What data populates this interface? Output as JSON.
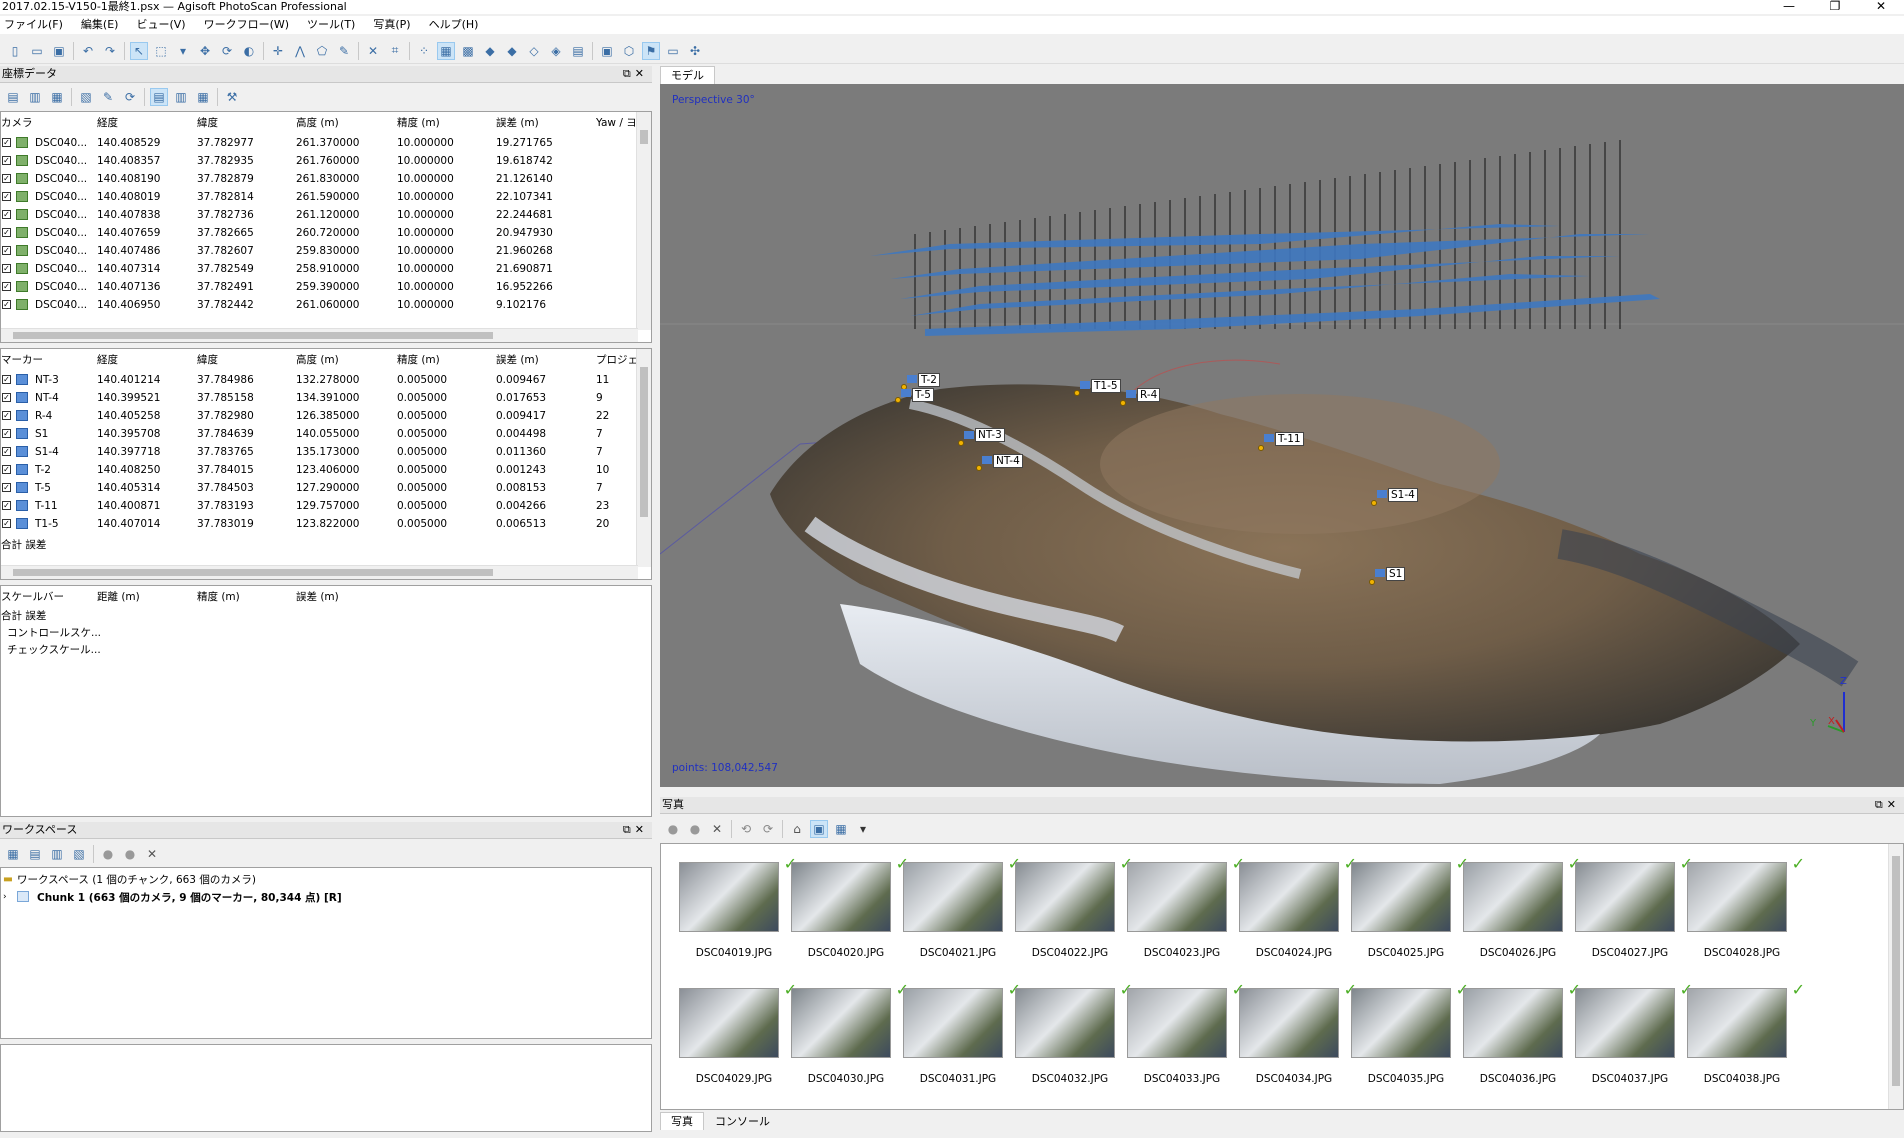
{
  "window": {
    "title": "2017.02.15-V150-1最終1.psx — Agisoft PhotoScan Professional",
    "min": "—",
    "max": "❐",
    "close": "✕"
  },
  "menu": [
    "ファイル(F)",
    "編集(E)",
    "ビュー(V)",
    "ワークフロー(W)",
    "ツール(T)",
    "写真(P)",
    "ヘルプ(H)"
  ],
  "reference": {
    "title": "座標データ",
    "cameras": {
      "headers": [
        "カメラ",
        "経度",
        "緯度",
        "高度 (m)",
        "精度 (m)",
        "誤差 (m)",
        "Yaw / ヨ"
      ],
      "rows": [
        [
          "DSC040...",
          "140.408529",
          "37.782977",
          "261.370000",
          "10.000000",
          "19.271765"
        ],
        [
          "DSC040...",
          "140.408357",
          "37.782935",
          "261.760000",
          "10.000000",
          "19.618742"
        ],
        [
          "DSC040...",
          "140.408190",
          "37.782879",
          "261.830000",
          "10.000000",
          "21.126140"
        ],
        [
          "DSC040...",
          "140.408019",
          "37.782814",
          "261.590000",
          "10.000000",
          "22.107341"
        ],
        [
          "DSC040...",
          "140.407838",
          "37.782736",
          "261.120000",
          "10.000000",
          "22.244681"
        ],
        [
          "DSC040...",
          "140.407659",
          "37.782665",
          "260.720000",
          "10.000000",
          "20.947930"
        ],
        [
          "DSC040...",
          "140.407486",
          "37.782607",
          "259.830000",
          "10.000000",
          "21.960268"
        ],
        [
          "DSC040...",
          "140.407314",
          "37.782549",
          "258.910000",
          "10.000000",
          "21.690871"
        ],
        [
          "DSC040...",
          "140.407136",
          "37.782491",
          "259.390000",
          "10.000000",
          "16.952266"
        ],
        [
          "DSC040...",
          "140.406950",
          "37.782442",
          "261.060000",
          "10.000000",
          "9.102176"
        ]
      ]
    },
    "markers": {
      "headers": [
        "マーカー",
        "経度",
        "緯度",
        "高度 (m)",
        "精度 (m)",
        "誤差 (m)",
        "プロジェ"
      ],
      "rows": [
        [
          "NT-3",
          "140.401214",
          "37.784986",
          "132.278000",
          "0.005000",
          "0.009467",
          "11"
        ],
        [
          "NT-4",
          "140.399521",
          "37.785158",
          "134.391000",
          "0.005000",
          "0.017653",
          "9"
        ],
        [
          "R-4",
          "140.405258",
          "37.782980",
          "126.385000",
          "0.005000",
          "0.009417",
          "22"
        ],
        [
          "S1",
          "140.395708",
          "37.784639",
          "140.055000",
          "0.005000",
          "0.004498",
          "7"
        ],
        [
          "S1-4",
          "140.397718",
          "37.783765",
          "135.173000",
          "0.005000",
          "0.011360",
          "7"
        ],
        [
          "T-2",
          "140.408250",
          "37.784015",
          "123.406000",
          "0.005000",
          "0.001243",
          "10"
        ],
        [
          "T-5",
          "140.405314",
          "37.784503",
          "127.290000",
          "0.005000",
          "0.008153",
          "7"
        ],
        [
          "T-11",
          "140.400871",
          "37.783193",
          "129.757000",
          "0.005000",
          "0.004266",
          "23"
        ],
        [
          "T1-5",
          "140.407014",
          "37.783019",
          "123.822000",
          "0.005000",
          "0.006513",
          "20"
        ]
      ],
      "total_label": "合計 誤差"
    },
    "scalebars": {
      "headers": [
        "スケールバー",
        "距離 (m)",
        "精度 (m)",
        "誤差 (m)"
      ],
      "total_label": "合計 誤差",
      "control": "コントロールスケ...",
      "check": "チェックスケール..."
    }
  },
  "workspace": {
    "title": "ワークスペース",
    "root": "ワークスペース (1 個のチャンク, 663 個のカメラ)",
    "chunk": "Chunk 1 (663 個のカメラ, 9 個のマーカー, 80,344 点) [R]"
  },
  "model": {
    "tab": "モデル",
    "perspective": "Perspective 30°",
    "points": "points: 108,042,547",
    "axes": {
      "z": "Z",
      "y": "Y",
      "x": "X"
    },
    "markers": [
      "T-2",
      "T-5",
      "T1-5",
      "R-4",
      "NT-3",
      "NT-4",
      "T-11",
      "S1-4",
      "S1"
    ]
  },
  "photos": {
    "title": "写真",
    "items": [
      "DSC04019.JPG",
      "DSC04020.JPG",
      "DSC04021.JPG",
      "DSC04022.JPG",
      "DSC04023.JPG",
      "DSC04024.JPG",
      "DSC04025.JPG",
      "DSC04026.JPG",
      "DSC04027.JPG",
      "DSC04028.JPG",
      "DSC04029.JPG",
      "DSC04030.JPG",
      "DSC04031.JPG",
      "DSC04032.JPG",
      "DSC04033.JPG",
      "DSC04034.JPG",
      "DSC04035.JPG",
      "DSC04036.JPG",
      "DSC04037.JPG",
      "DSC04038.JPG"
    ]
  },
  "bottom_tabs": [
    "写真",
    "コンソール"
  ]
}
